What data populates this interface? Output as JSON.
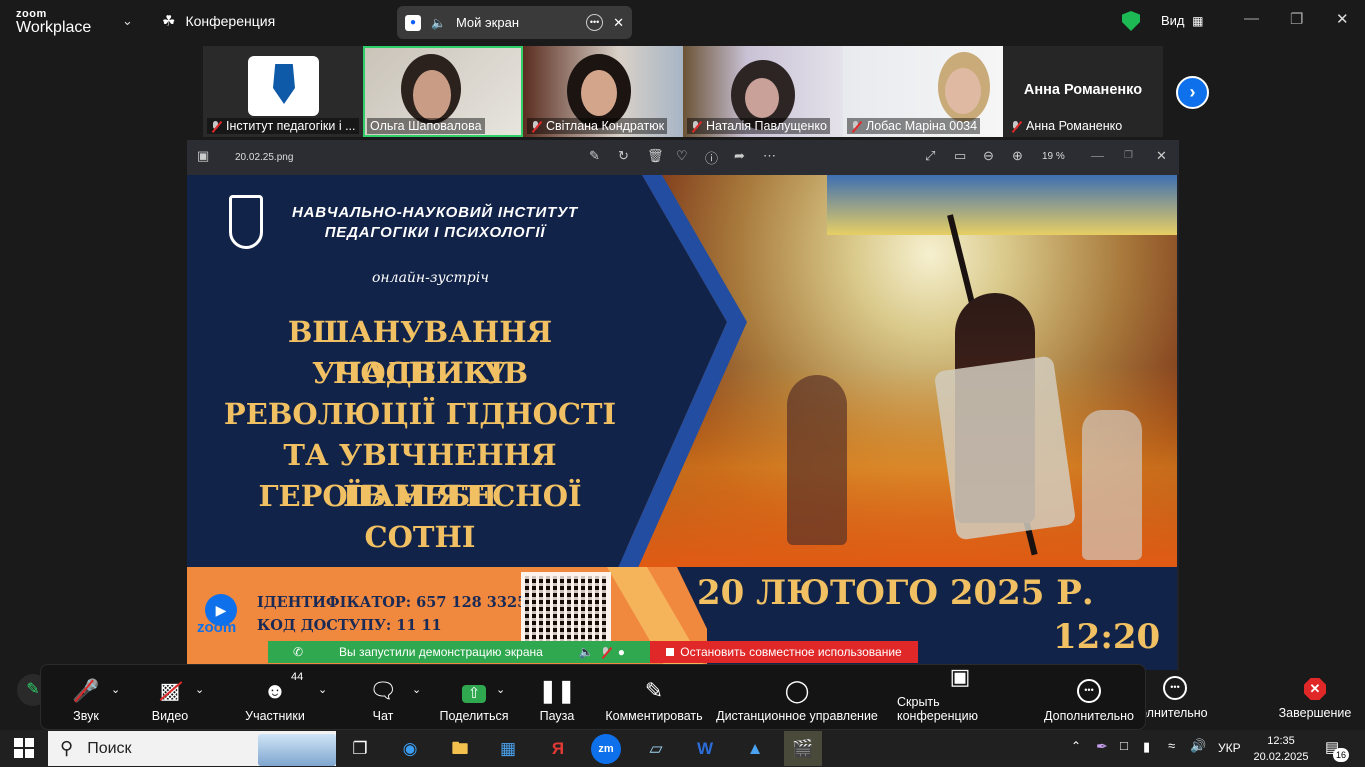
{
  "zoom": {
    "logo_small": "zoom",
    "logo_big": "Workplace",
    "conference_label": "Конференция",
    "screen_pill_label": "Мой экран",
    "view_label": "Вид"
  },
  "participants": [
    {
      "name": "Інститут педагогіки і ..."
    },
    {
      "name": "Ольга Шаповалова"
    },
    {
      "name": "Світлана Кондратюк"
    },
    {
      "name": "Наталія Павлущенко"
    },
    {
      "name": "Лобас Маріна 0034"
    },
    {
      "name": "Анна Романенко",
      "tile_text": "Анна Романенко"
    }
  ],
  "viewer": {
    "filename": "20.02.25.png",
    "zoom": "19 %"
  },
  "poster": {
    "institute_line1": "НАВЧАЛЬНО-НАУКОВИЙ ІНСТИТУТ",
    "institute_line2": "ПЕДАГОГІКИ І ПСИХОЛОГІЇ",
    "event_type": "онлайн-зустріч",
    "title_lines": [
      "ВШАНУВАННЯ ПОДВИГУ",
      "УЧАСНИКІВ",
      "РЕВОЛЮЦІЇ ГІДНОСТІ",
      "ТА УВІЧНЕННЯ ПАМ’ЯТІ",
      "ГЕРОЇВ НЕБЕСНОЇ СОТНІ"
    ],
    "zoom_word": "zoom",
    "id_line": "ІДЕНТИФІКАТОР: 657 128 3325",
    "code_line": "КОД ДОСТУПУ: 11 11",
    "date": "20 ЛЮТОГО 2025 Р.",
    "time": "12:20"
  },
  "share": {
    "started": "Вы запустили демонстрацию экрана",
    "stop": "Остановить совместное использование"
  },
  "toolbar": {
    "audio": "Звук",
    "video": "Видео",
    "participants": "Участники",
    "participants_count": "44",
    "chat": "Чат",
    "share": "Поделиться",
    "pause": "Пауза",
    "annotate": "Комментировать",
    "remote": "Дистанционное управление",
    "hide": "Скрыть конференцию",
    "more": "Дополнительно",
    "more_cut": "олнительно",
    "end": "Завершение"
  },
  "taskbar": {
    "search": "Поиск",
    "lang": "УКР",
    "time": "12:35",
    "date": "20.02.2025",
    "notif_count": "16"
  },
  "colors": {
    "zoom_blue": "#0e71eb",
    "share_green": "#2fa84f",
    "stop_red": "#e02828",
    "poster_navy": "#122349",
    "poster_gold": "#f0c062",
    "poster_orange": "#f0883e"
  }
}
